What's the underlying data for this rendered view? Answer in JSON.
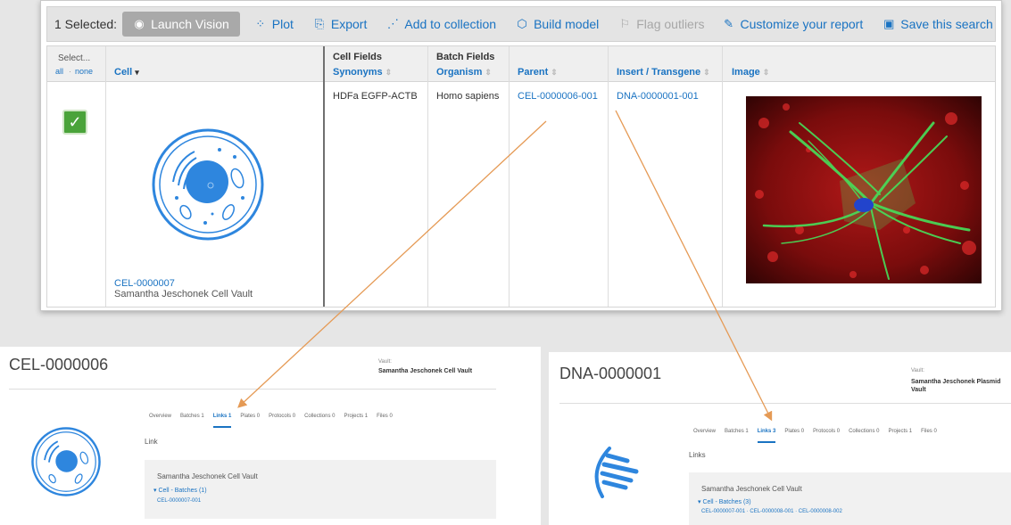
{
  "toolbar": {
    "selected_label": "1 Selected:",
    "launch_vision": "Launch Vision",
    "plot": "Plot",
    "export": "Export",
    "add_to_collection": "Add to collection",
    "build_model": "Build model",
    "flag_outliers": "Flag outliers",
    "customize_report": "Customize your report",
    "save_search": "Save this search"
  },
  "table": {
    "select_header": "Select...",
    "select_all": "all",
    "select_none": "none",
    "cell_header": "Cell",
    "cell_fields_group": "Cell Fields",
    "batch_fields_group": "Batch Fields",
    "columns": {
      "synonyms": "Synonyms",
      "organism": "Organism",
      "parent": "Parent",
      "insert_transgene": "Insert / Transgene",
      "image": "Image"
    },
    "row": {
      "selected": true,
      "cell_id": "CEL-0000007",
      "cell_vault": "Samantha Jeschonek Cell Vault",
      "synonyms": "HDFa EGFP-ACTB",
      "organism": "Homo sapiens",
      "parent": "CEL-0000006-001",
      "insert_transgene": "DNA-0000001-001"
    }
  },
  "detail_cell": {
    "title": "CEL-0000006",
    "vault_label": "Vault:",
    "vault_value": "Samantha Jeschonek Cell Vault",
    "tabs": [
      "Overview",
      "Batches 1",
      "Links 1",
      "Plates 0",
      "Protocols 0",
      "Collections 0",
      "Projects 1",
      "Files 0"
    ],
    "active_tab": "Links 1",
    "section": "Link",
    "link_vault": "Samantha Jeschonek Cell Vault",
    "link_batches": "▾ Cell - Batches (1)",
    "link_ids": "CEL-0000007-001"
  },
  "detail_dna": {
    "title": "DNA-0000001",
    "vault_label": "Vault:",
    "vault_value": "Samantha Jeschonek Plasmid Vault",
    "tabs": [
      "Overview",
      "Batches 1",
      "Links 3",
      "Plates 0",
      "Protocols 0",
      "Collections 0",
      "Projects 1",
      "Files 0"
    ],
    "active_tab": "Links 3",
    "section": "Links",
    "link_vault": "Samantha Jeschonek Cell Vault",
    "link_batches": "▾ Cell - Batches (3)",
    "link_ids": "CEL-0000007-001 · CEL-0000008-001 · CEL-0000008-002"
  },
  "colors": {
    "link_blue": "#1a73c2",
    "check_green": "#4aa33a",
    "arrow_orange": "#e59a55",
    "cell_icon_blue": "#2e86de"
  },
  "icons": {
    "vision": "eye-icon",
    "plot": "scatter-plot-icon",
    "export": "export-icon",
    "collection": "collection-icon",
    "model": "cube-icon",
    "outliers": "flag-icon",
    "report": "edit-report-icon",
    "save": "save-icon"
  }
}
